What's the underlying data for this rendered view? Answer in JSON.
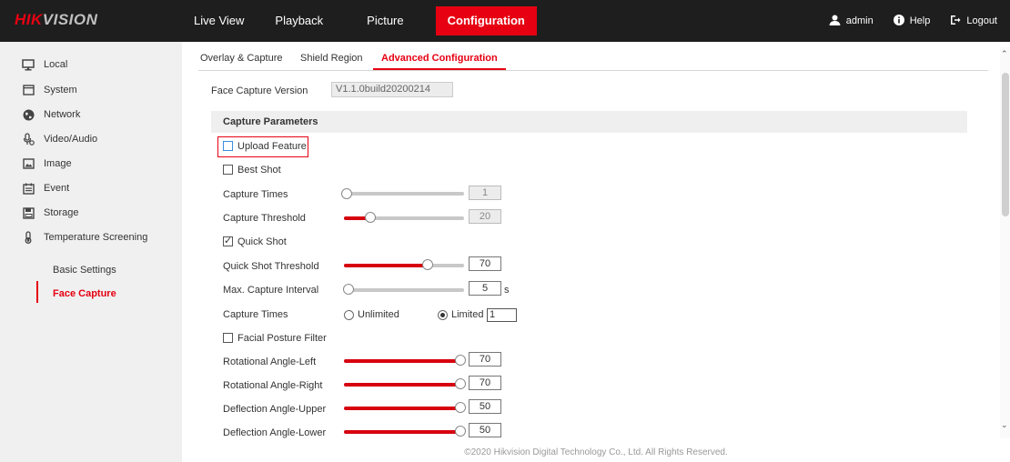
{
  "brand": {
    "logo_part1": "HIK",
    "logo_part2": "VISION"
  },
  "nav": {
    "items": [
      "Live View",
      "Playback",
      "Picture",
      "Configuration"
    ],
    "active": "Configuration"
  },
  "user": {
    "admin": "admin",
    "help": "Help",
    "logout": "Logout"
  },
  "sidebar": {
    "items": [
      "Local",
      "System",
      "Network",
      "Video/Audio",
      "Image",
      "Event",
      "Storage",
      "Temperature Screening"
    ],
    "subitems": [
      "Basic Settings",
      "Face Capture"
    ],
    "active_sub": "Face Capture"
  },
  "tabs": {
    "items": [
      "Overlay & Capture",
      "Shield Region",
      "Advanced Configuration"
    ],
    "active": "Advanced Configuration"
  },
  "form": {
    "face_capture_version_label": "Face Capture Version",
    "face_capture_version_value": "V1.1.0build20200214",
    "section_title": "Capture Parameters",
    "upload_feature": {
      "label": "Upload Feature",
      "checked": false
    },
    "best_shot": {
      "label": "Best Shot",
      "checked": false
    },
    "capture_times_slider": {
      "label": "Capture Times",
      "value": "1",
      "fraction": 0.0,
      "enabled": false
    },
    "capture_threshold": {
      "label": "Capture Threshold",
      "value": "20",
      "fraction": 0.2,
      "enabled": false
    },
    "quick_shot": {
      "label": "Quick Shot",
      "checked": true
    },
    "quick_shot_threshold": {
      "label": "Quick Shot Threshold",
      "value": "70",
      "fraction": 0.7
    },
    "max_capture_interval": {
      "label": "Max. Capture Interval",
      "value": "5",
      "unit": "s",
      "fraction": 0.02
    },
    "capture_times_mode": {
      "label": "Capture Times",
      "option_unlimited": "Unlimited",
      "option_limited": "Limited",
      "selected": "Limited",
      "limited_value": "1"
    },
    "facial_posture_filter": {
      "label": "Facial Posture Filter",
      "checked": false
    },
    "rotational_left": {
      "label": "Rotational Angle-Left",
      "value": "70",
      "fraction": 1.0
    },
    "rotational_right": {
      "label": "Rotational Angle-Right",
      "value": "70",
      "fraction": 1.0
    },
    "deflection_upper": {
      "label": "Deflection Angle-Upper",
      "value": "50",
      "fraction": 1.0
    },
    "deflection_lower": {
      "label": "Deflection Angle-Lower",
      "value": "50",
      "fraction": 1.0
    }
  },
  "footer": "©2020 Hikvision Digital Technology Co., Ltd. All Rights Reserved.",
  "colors": {
    "accent": "#e60012",
    "topbar": "#1e1e1e",
    "sidebar": "#f0f0f0"
  }
}
